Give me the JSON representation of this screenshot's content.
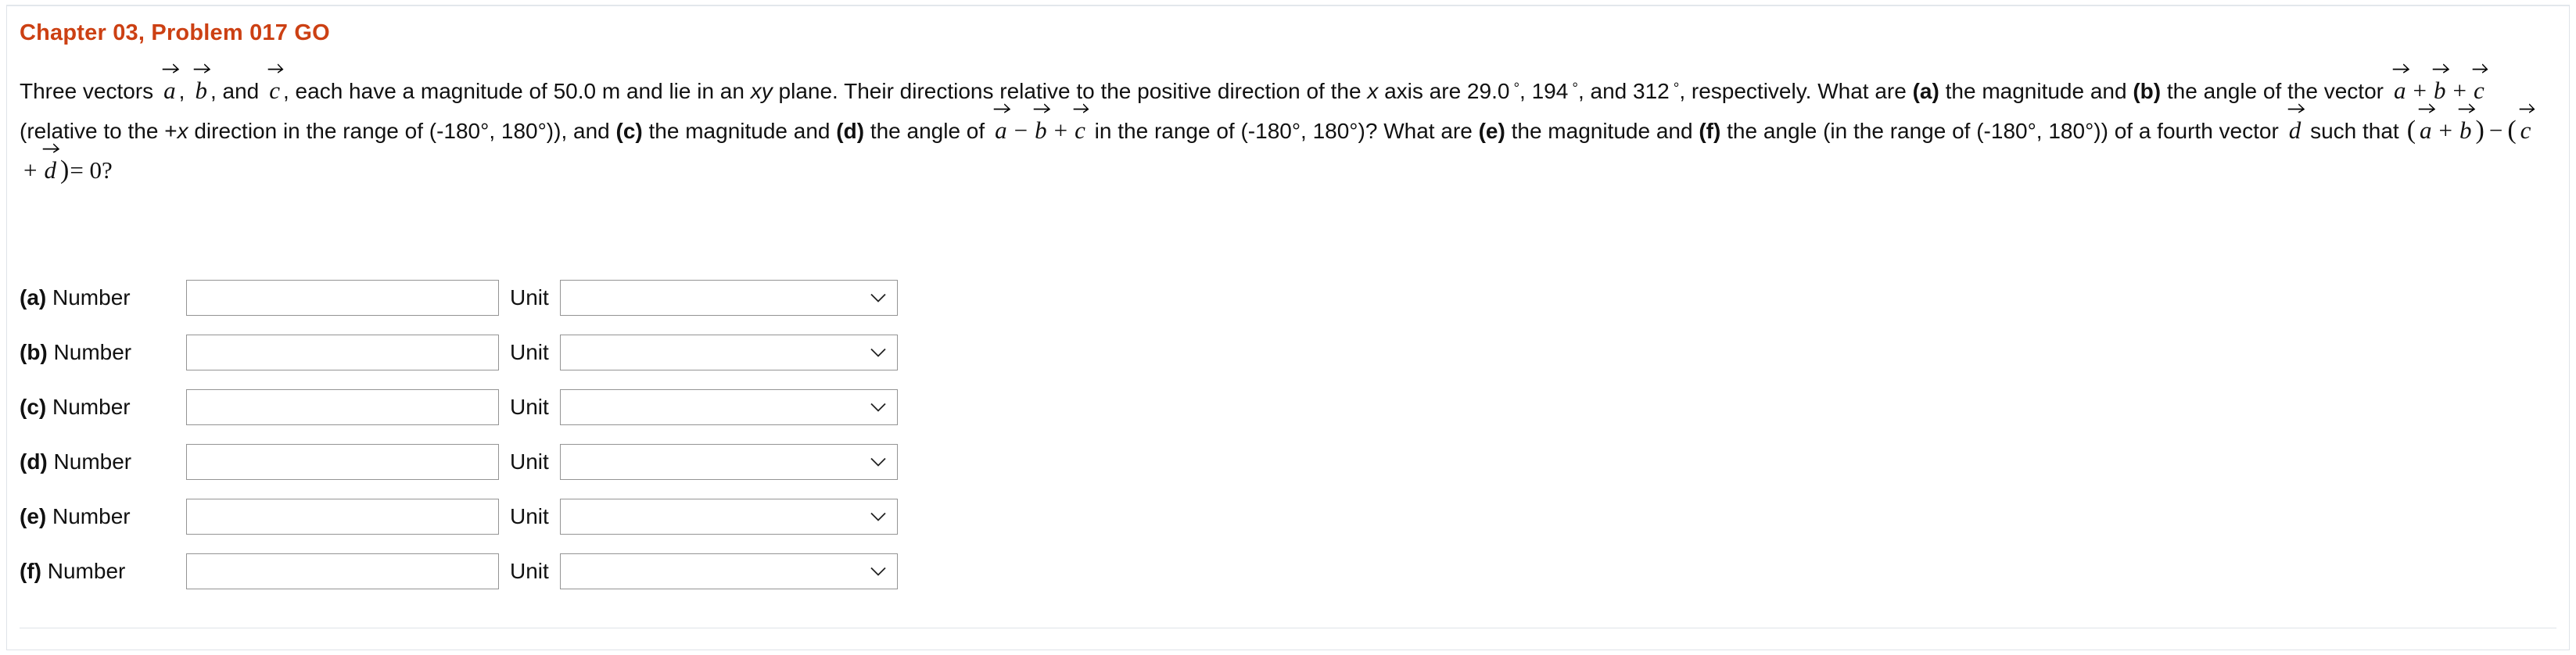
{
  "problem": {
    "title": "Chapter 03, Problem 017 GO",
    "title_color": "#cc4013",
    "statement_parts": {
      "s1": "Three vectors",
      "vec_a": "a",
      "comma1": ",",
      "vec_b": "b",
      "comma2": ", and",
      "vec_c": "c",
      "s2": ", each have a magnitude of 50.0 m and lie in an",
      "xy": "xy",
      "s3": "plane. Their directions relative to the positive direction of the",
      "x1": "x",
      "s4": "axis are 29.0",
      "deg1": "°",
      "s5": ", 194",
      "deg2": "°",
      "s6": ", and 312",
      "deg3": "°",
      "s7": ", respectively. What are",
      "label_a": "(a)",
      "s8": "the magnitude and",
      "label_b": "(b)",
      "s9": "the angle of the vector",
      "plus1": "+",
      "plus2": "+",
      "s10": "(relative to the +",
      "x2": "x",
      "s11": "direction in the range of (-180°, 180°)), and",
      "label_c": "(c)",
      "s12": "the magnitude and",
      "label_d": "(d)",
      "s13": "the angle of",
      "minus1": "−",
      "plus3": "+",
      "s14": "in the range of (-180°, 180°)?",
      "s15": "What are",
      "label_e": "(e)",
      "s16": "the magnitude and",
      "label_f": "(f)",
      "s17": "the angle (in the range of (-180°, 180°)) of a fourth vector",
      "vec_d": "d",
      "s18": "such that",
      "paren_open1": "(",
      "plus4": "+",
      "paren_close1": ")",
      "minus2": "−",
      "paren_open2": "(",
      "plus5": "+",
      "paren_close2": ")",
      "equals": "= 0?"
    },
    "magnitude": "50.0 m",
    "angles": [
      "29.0°",
      "194°",
      "312°"
    ],
    "angle_range": "(-180°, 180°)"
  },
  "answers": {
    "number_label": "Number",
    "unit_label": "Unit",
    "input_placeholder": "",
    "unit_selected": "",
    "unit_options": [
      ""
    ],
    "rows": [
      {
        "key": "(a)",
        "value": ""
      },
      {
        "key": "(b)",
        "value": ""
      },
      {
        "key": "(c)",
        "value": ""
      },
      {
        "key": "(d)",
        "value": ""
      },
      {
        "key": "(e)",
        "value": ""
      },
      {
        "key": "(f)",
        "value": ""
      }
    ]
  },
  "icons": {
    "chevron_down": "chevron-down-icon",
    "vector_arrow": "vector-arrow-icon"
  }
}
